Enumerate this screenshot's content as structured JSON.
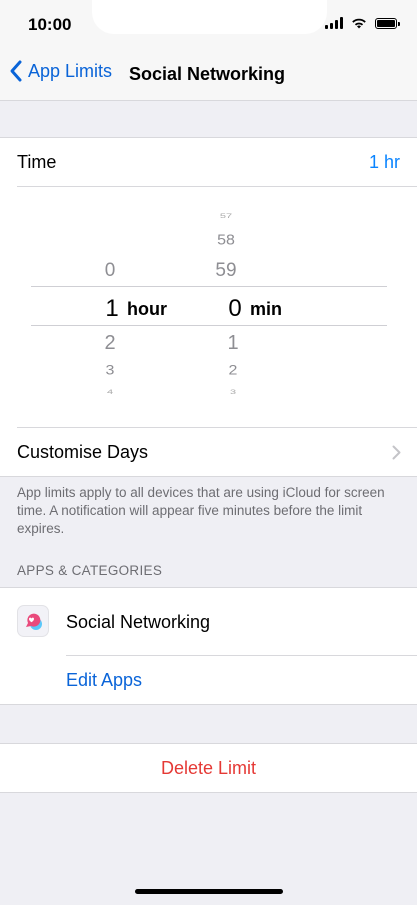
{
  "status_bar": {
    "time": "10:00"
  },
  "nav": {
    "back_label": "App Limits",
    "title": "Social Networking"
  },
  "time_row": {
    "label": "Time",
    "value": "1 hr"
  },
  "picker": {
    "hours": {
      "above": [
        "0"
      ],
      "selected": "1",
      "below": [
        "2",
        "3",
        "4"
      ],
      "unit": "hour"
    },
    "minutes": {
      "above": [
        "57",
        "58",
        "59"
      ],
      "selected": "0",
      "below": [
        "1",
        "2",
        "3"
      ],
      "unit": "min"
    }
  },
  "customise_days": {
    "label": "Customise Days"
  },
  "note": "App limits apply to all devices that are using iCloud for screen time. A notification will appear five minutes before the limit expires.",
  "apps_section": {
    "header": "APPS & CATEGORIES",
    "items": [
      {
        "label": "Social Networking",
        "icon": "social-networking-icon"
      }
    ],
    "edit_label": "Edit Apps"
  },
  "delete": {
    "label": "Delete Limit"
  },
  "colors": {
    "accent": "#0a84ff",
    "destructive": "#e53935",
    "background": "#efeff4"
  }
}
